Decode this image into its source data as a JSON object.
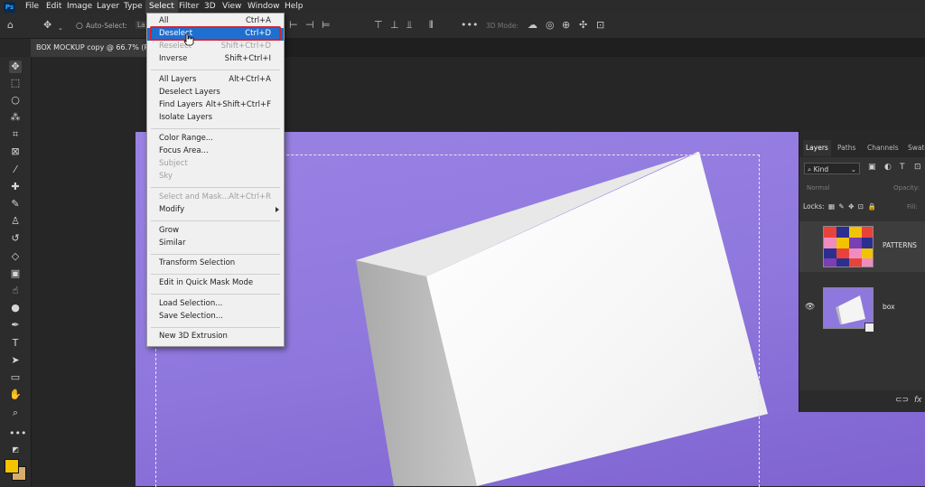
{
  "app": {
    "logo": "Ps"
  },
  "menubar": {
    "items": [
      "File",
      "Edit",
      "Image",
      "Layer",
      "Type",
      "Select",
      "Filter",
      "3D",
      "View",
      "Window",
      "Help"
    ],
    "active": "Select"
  },
  "options": {
    "auto_select_label": "Auto-Select:",
    "auto_select_value": "La",
    "mode_3d": "3D Mode:"
  },
  "document": {
    "tab_title": "BOX MOCKUP copy @ 66.7% (P"
  },
  "select_menu": {
    "items": [
      {
        "label": "All",
        "shortcut": "Ctrl+A"
      },
      {
        "label": "Deselect",
        "shortcut": "Ctrl+D"
      },
      {
        "label": "Reselect",
        "shortcut": "Shift+Ctrl+D"
      },
      {
        "label": "Inverse",
        "shortcut": "Shift+Ctrl+I"
      },
      {
        "label": "All Layers",
        "shortcut": "Alt+Ctrl+A"
      },
      {
        "label": "Deselect Layers",
        "shortcut": ""
      },
      {
        "label": "Find Layers",
        "shortcut": "Alt+Shift+Ctrl+F"
      },
      {
        "label": "Isolate Layers",
        "shortcut": ""
      },
      {
        "label": "Color Range...",
        "shortcut": ""
      },
      {
        "label": "Focus Area...",
        "shortcut": ""
      },
      {
        "label": "Subject",
        "shortcut": ""
      },
      {
        "label": "Sky",
        "shortcut": ""
      },
      {
        "label": "Select and Mask...",
        "shortcut": "Alt+Ctrl+R"
      },
      {
        "label": "Modify",
        "shortcut": ""
      },
      {
        "label": "Grow",
        "shortcut": ""
      },
      {
        "label": "Similar",
        "shortcut": ""
      },
      {
        "label": "Transform Selection",
        "shortcut": ""
      },
      {
        "label": "Edit in Quick Mask Mode",
        "shortcut": ""
      },
      {
        "label": "Load Selection...",
        "shortcut": ""
      },
      {
        "label": "Save Selection...",
        "shortcut": ""
      },
      {
        "label": "New 3D Extrusion",
        "shortcut": ""
      }
    ]
  },
  "layers_panel": {
    "tabs": [
      "Layers",
      "Paths",
      "Channels",
      "Swatc"
    ],
    "kind_label": "Kind",
    "blend_mode": "Normal",
    "opacity_label": "Opacity:",
    "locks_label": "Locks:",
    "fill_label": "Fill:",
    "layers": [
      {
        "name": "PATTERNS"
      },
      {
        "name": "box"
      }
    ]
  },
  "colors": {
    "foreground": "#f2c300",
    "background": "#d6ad6b",
    "canvas": "#8f78dd",
    "highlight": "#1f6fd1",
    "outline": "#d9232e"
  }
}
